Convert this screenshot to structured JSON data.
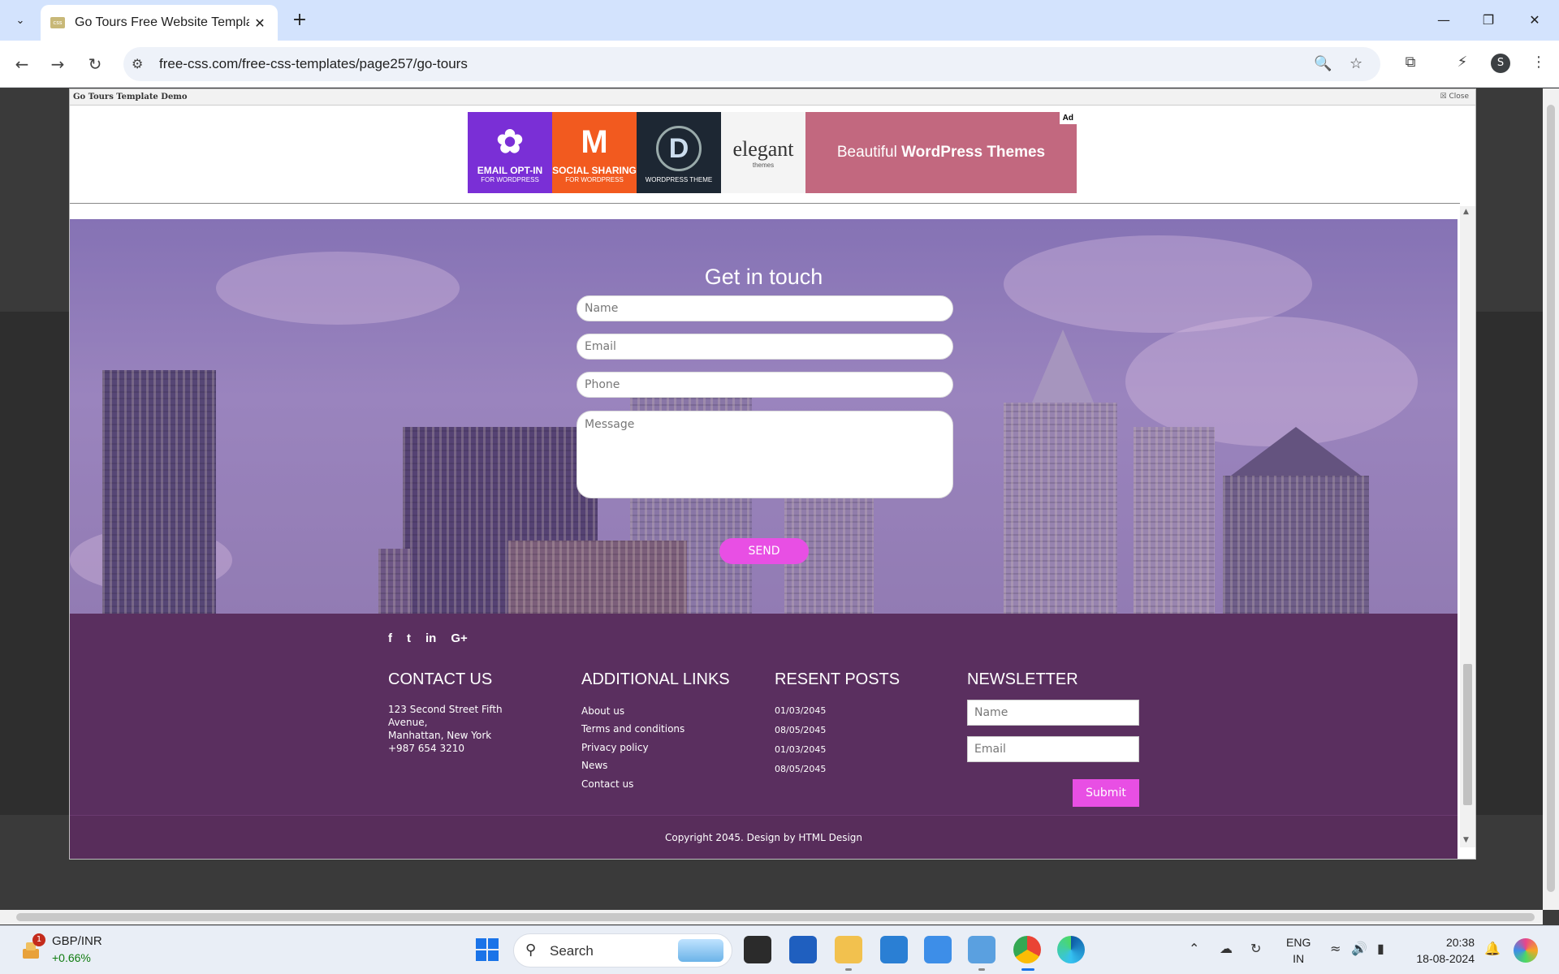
{
  "browser": {
    "tab_title": "Go Tours Free Website Template",
    "url": "free-css.com/free-css-templates/page257/go-tours",
    "profile_initial": "S"
  },
  "demo_frame": {
    "title": "Go Tours Template Demo",
    "close_label": "Close"
  },
  "ad": {
    "tiles": [
      {
        "big": "EMAIL OPT-IN",
        "small": "FOR WORDPRESS",
        "color": "#7a2fd6"
      },
      {
        "big": "SOCIAL SHARING",
        "small": "FOR WORDPRESS",
        "color": "#f25a1f"
      },
      {
        "big": "",
        "small": "WORDPRESS THEME",
        "color": "#1d2733"
      },
      {
        "big": "elegant",
        "small": "themes",
        "color": "#f4f4f4"
      }
    ],
    "banner_text_light": "Beautiful",
    "banner_text_bold": "WordPress Themes",
    "badge": "Ad"
  },
  "contact": {
    "title": "Get in touch",
    "name_placeholder": "Name",
    "email_placeholder": "Email",
    "phone_placeholder": "Phone",
    "message_placeholder": "Message",
    "send_label": "SEND"
  },
  "footer": {
    "social": [
      "f",
      "t",
      "in",
      "G+"
    ],
    "contact_title": "CONTACT US",
    "address_line1": "123 Second Street Fifth",
    "address_line2": "Avenue,",
    "address_line3": "Manhattan, New York",
    "phone": "+987 654 3210",
    "links_title": "ADDITIONAL LINKS",
    "links": [
      "About us",
      "Terms and conditions",
      "Privacy policy",
      "News",
      "Contact us"
    ],
    "posts_title": "RESENT POSTS",
    "posts": [
      "01/03/2045",
      "08/05/2045",
      "01/03/2045",
      "08/05/2045"
    ],
    "newsletter_title": "NEWSLETTER",
    "newsletter_name_placeholder": "Name",
    "newsletter_email_placeholder": "Email",
    "submit_label": "Submit",
    "copyright": "Copyright 2045. Design by HTML Design"
  },
  "taskbar": {
    "ticker_name": "GBP/INR",
    "ticker_change": "+0.66%",
    "ticker_badge": "1",
    "search_label": "Search",
    "lang_line1": "ENG",
    "lang_line2": "IN",
    "time": "20:38",
    "date": "18-08-2024"
  }
}
